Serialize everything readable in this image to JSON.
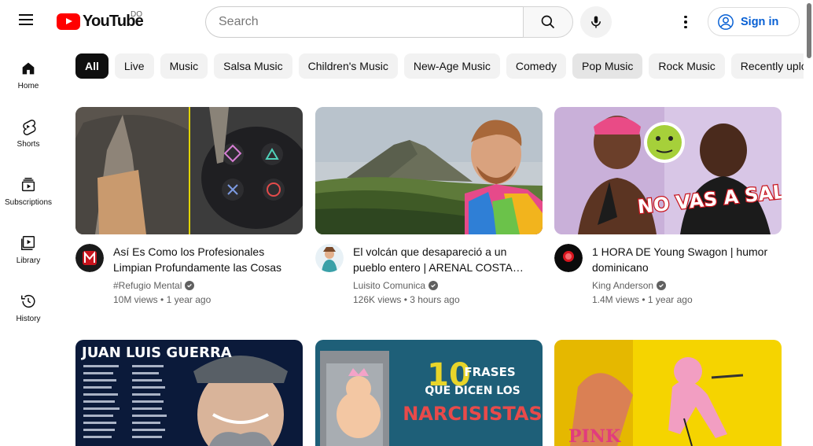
{
  "header": {
    "logo_text": "YouTube",
    "country_code": "DO",
    "search_placeholder": "Search",
    "signin_label": "Sign in"
  },
  "sidebar": {
    "items": [
      {
        "label": "Home",
        "icon": "home-icon"
      },
      {
        "label": "Shorts",
        "icon": "shorts-icon"
      },
      {
        "label": "Subscriptions",
        "icon": "subscriptions-icon"
      },
      {
        "label": "Library",
        "icon": "library-icon"
      },
      {
        "label": "History",
        "icon": "history-icon"
      }
    ]
  },
  "chips": [
    "All",
    "Live",
    "Music",
    "Salsa Music",
    "Children's Music",
    "New-Age Music",
    "Comedy",
    "Pop Music",
    "Rock Music",
    "Recently uploaded"
  ],
  "videos": [
    {
      "title": "Así Es Como los Profesionales Limpian Profundamente las Cosas",
      "channel": "#Refugio Mental",
      "views": "10M views",
      "age": "1 year ago"
    },
    {
      "title": "El volcán que desapareció a un pueblo entero | ARENAL COSTA…",
      "channel": "Luisito Comunica",
      "views": "126K views",
      "age": "3 hours ago"
    },
    {
      "title": "1 HORA DE Young Swagon | humor dominicano",
      "channel": "King Anderson",
      "views": "1.4M views",
      "age": "1 year ago"
    }
  ],
  "thumb_text": {
    "v3_overlay": "NO VAS A SALIR",
    "v4_title": "JUAN LUIS GUERRA",
    "v5_number": "10",
    "v5_line1": "FRASES",
    "v5_line2": "QUE DICEN LOS",
    "v5_line3": "NARCISISTAS",
    "v6_word": "PINK"
  },
  "colors": {
    "brand_red": "#ff0000",
    "link_blue": "#065fd4",
    "text_secondary": "#606060"
  }
}
